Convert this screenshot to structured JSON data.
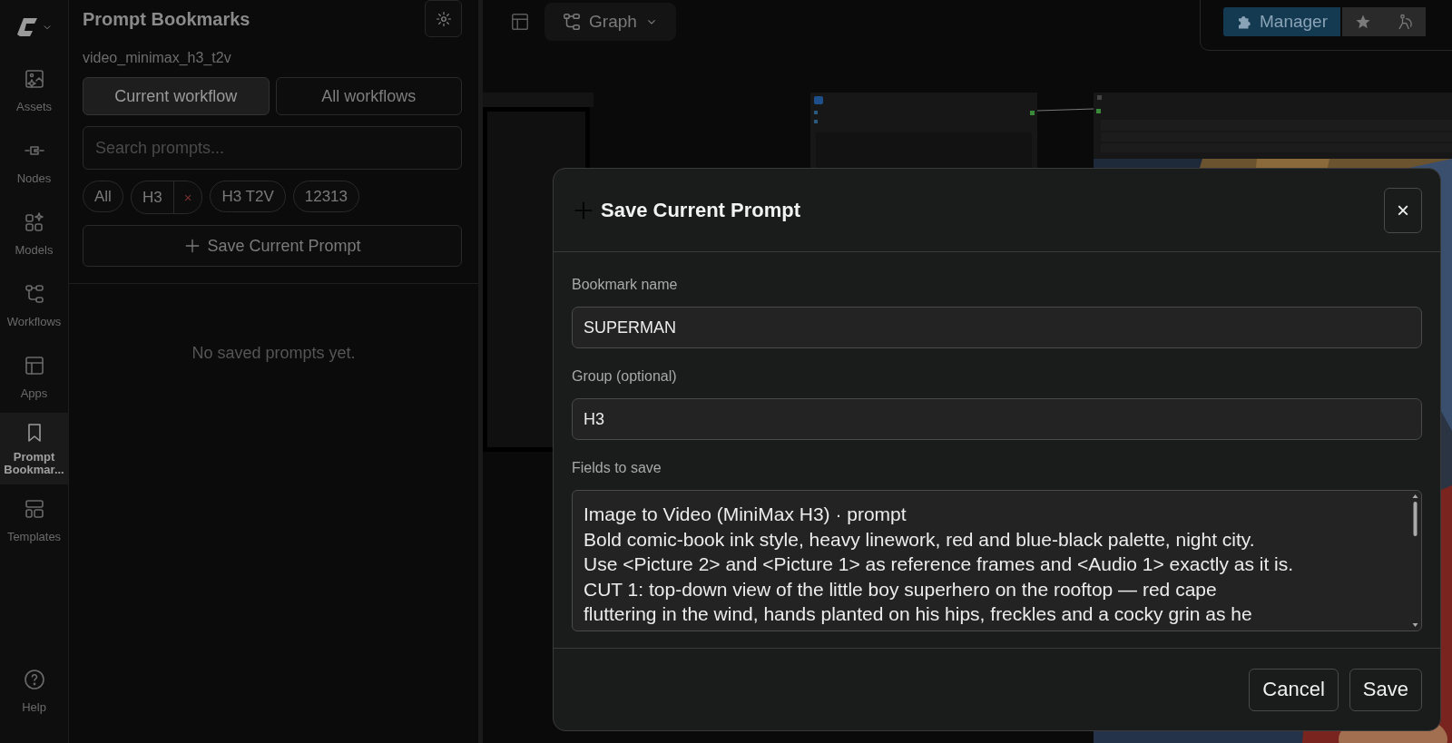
{
  "rail": {
    "items": [
      {
        "kind": "assets",
        "label": "Assets",
        "selected": false
      },
      {
        "kind": "nodes",
        "label": "Nodes",
        "selected": false
      },
      {
        "kind": "models",
        "label": "Models",
        "selected": false
      },
      {
        "kind": "workflows",
        "label": "Workflows",
        "selected": false
      },
      {
        "kind": "apps",
        "label": "Apps",
        "selected": false
      },
      {
        "kind": "bookmark",
        "label": "Prompt Bookmar...",
        "selected": true
      },
      {
        "kind": "templates",
        "label": "Templates",
        "selected": false
      }
    ],
    "help": {
      "label": "Help"
    }
  },
  "panel": {
    "title": "Prompt Bookmarks",
    "workflow": "video_minimax_h3_t2v",
    "tabs": [
      {
        "label": "Current workflow",
        "selected": true
      },
      {
        "label": "All workflows",
        "selected": false
      }
    ],
    "search": {
      "placeholder": "Search prompts..."
    },
    "chips": [
      {
        "label": "All"
      },
      {
        "label": "H3",
        "remove": "×"
      },
      {
        "label": "H3 T2V"
      },
      {
        "label": "12313"
      }
    ],
    "save_button": "Save Current Prompt",
    "empty_message": "No saved prompts yet."
  },
  "canvas": {
    "view_menu": "Graph",
    "manager_button": "Manager"
  },
  "dialog": {
    "title": "Save Current Prompt",
    "close": "×",
    "fields": [
      {
        "label": "Bookmark name",
        "value": "SUPERMAN"
      },
      {
        "label": "Group (optional)",
        "value": "H3"
      }
    ],
    "fields_to_save": {
      "label": "Fields to save",
      "value": "Image to Video (MiniMax H3) · prompt\nBold comic-book ink style, heavy linework, red and blue-black palette, night city.\nUse <Picture 2> and <Picture 1> as reference frames and <Audio 1> exactly as it is.\nCUT 1: top-down view of the little boy superhero on the rooftop — red cape\nfluttering in the wind, hands planted on his hips, freckles and a cocky grin as he"
    },
    "buttons": [
      {
        "label": "Cancel"
      },
      {
        "label": "Save"
      }
    ]
  }
}
